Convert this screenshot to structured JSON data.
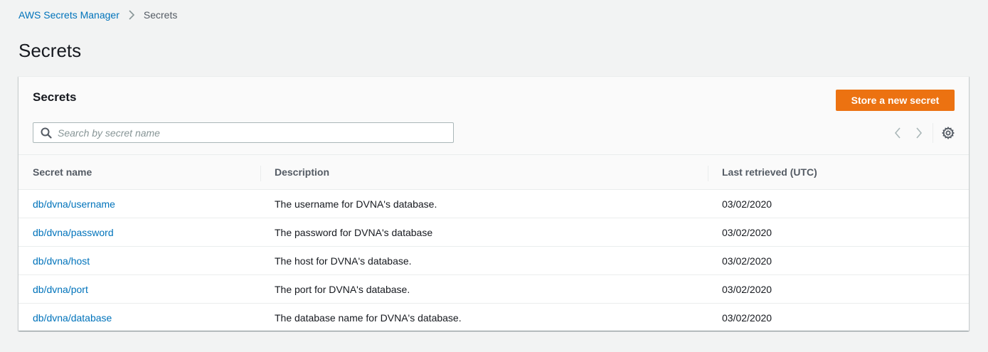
{
  "breadcrumb": {
    "root": "AWS Secrets Manager",
    "current": "Secrets"
  },
  "page": {
    "title": "Secrets"
  },
  "panel": {
    "title": "Secrets",
    "store_button_label": "Store a new secret",
    "search": {
      "placeholder": "Search by secret name",
      "value": ""
    }
  },
  "table": {
    "headers": {
      "name": "Secret name",
      "description": "Description",
      "last_retrieved": "Last retrieved (UTC)"
    },
    "rows": [
      {
        "name": "db/dvna/username",
        "description": "The username for DVNA's database.",
        "last_retrieved": "03/02/2020"
      },
      {
        "name": "db/dvna/password",
        "description": "The password for DVNA's database",
        "last_retrieved": "03/02/2020"
      },
      {
        "name": "db/dvna/host",
        "description": "The host for DVNA's database.",
        "last_retrieved": "03/02/2020"
      },
      {
        "name": "db/dvna/port",
        "description": "The port for DVNA's database.",
        "last_retrieved": "03/02/2020"
      },
      {
        "name": "db/dvna/database",
        "description": "The database name for DVNA's database.",
        "last_retrieved": "03/02/2020"
      }
    ]
  },
  "icons": {
    "breadcrumb_separator": "chevron-right-icon",
    "search": "search-icon",
    "prev_page": "chevron-left-icon",
    "next_page": "chevron-right-icon",
    "preferences": "gear-icon"
  },
  "colors": {
    "link": "#0073bb",
    "primary_button": "#ec7211",
    "background": "#f2f3f3"
  }
}
